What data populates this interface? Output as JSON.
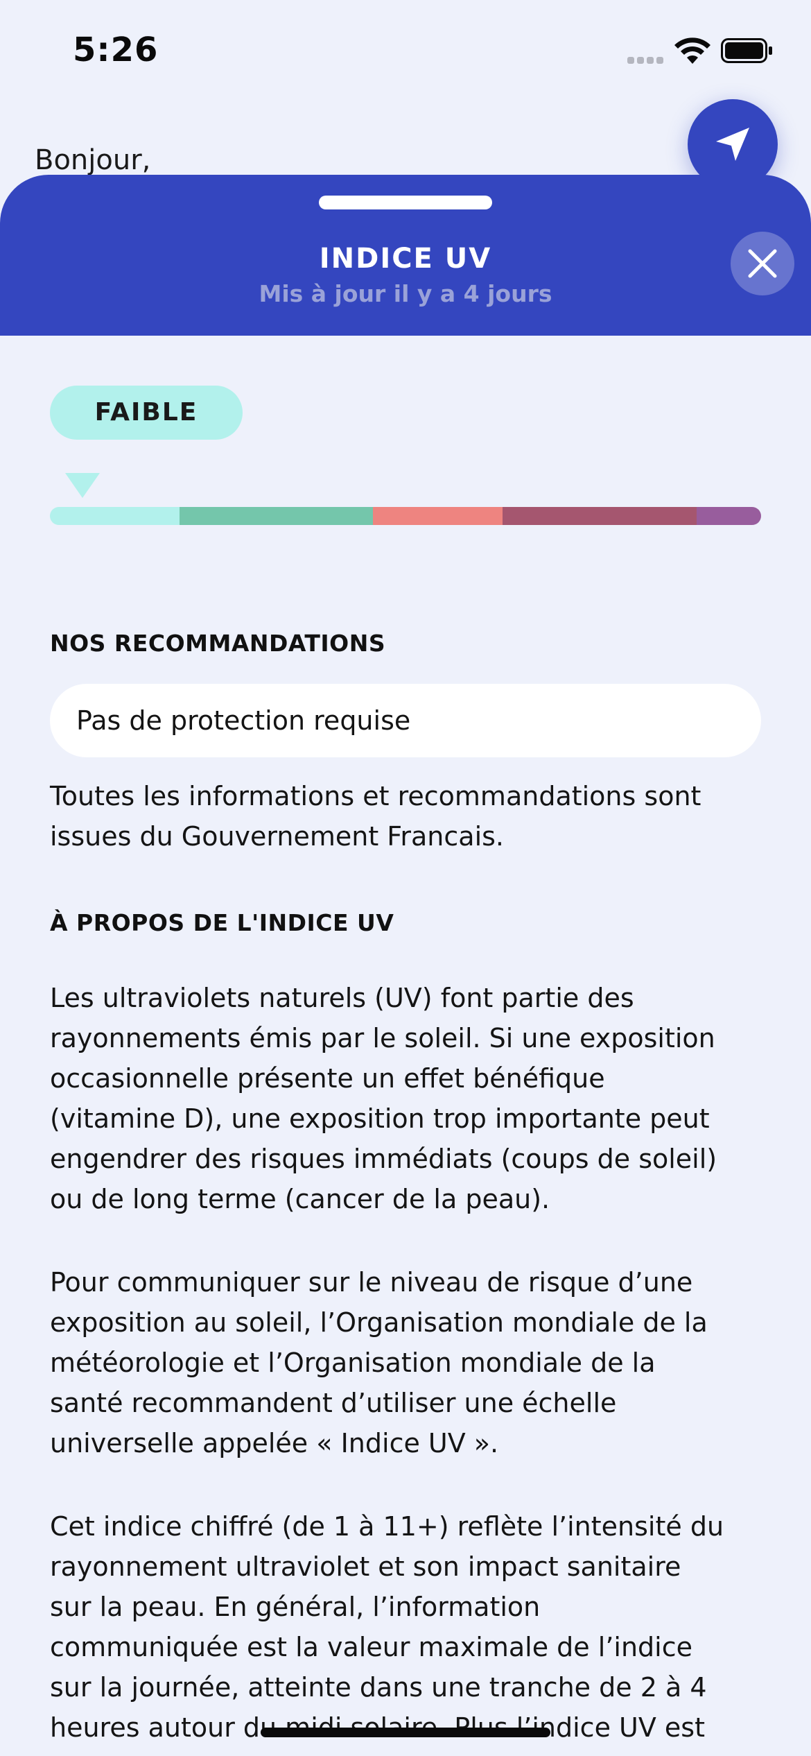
{
  "status_bar": {
    "time": "5:26"
  },
  "background": {
    "greeting": "Bonjour,"
  },
  "sheet": {
    "title": "INDICE UV",
    "subtitle": "Mis à jour il y a 4 jours"
  },
  "uv_level": {
    "label": "FAIBLE",
    "scale_colors": [
      "#b2f1ec",
      "#74c6ab",
      "#ee8480",
      "#a5566f",
      "#985d9d"
    ],
    "scale_segment_weights": [
      2,
      3,
      2,
      3,
      1
    ],
    "current_index": 0
  },
  "recommendations": {
    "title": "NOS RECOMMANDATIONS",
    "text": "Pas de protection requise",
    "source_lines": [
      "Toutes les informations et recommandations sont",
      "issues du Gouvernement Francais."
    ]
  },
  "about": {
    "title": "À PROPOS DE L'INDICE UV",
    "paragraph1": [
      "Les ultraviolets naturels (UV) font partie des",
      "rayonnements émis par le soleil. Si une exposition",
      "occasionnelle présente un effet bénéfique",
      "(vitamine D), une exposition trop importante peut",
      "engendrer des risques immédiats (coups de soleil)",
      "ou de long terme (cancer de la peau)."
    ],
    "paragraph2": [
      "Pour communiquer sur le niveau de risque d’une",
      "exposition au soleil, l’Organisation mondiale de la",
      "météorologie et l’Organisation mondiale de la",
      "santé recommandent d’utiliser une échelle",
      "universelle appelée « Indice UV »."
    ],
    "paragraph3": [
      "Cet indice chiffré (de 1 à 11+) reflète l’intensité du",
      "rayonnement ultraviolet et son impact sanitaire",
      "sur la peau. En général, l’information",
      "communiquée est la valeur maximale de l’indice",
      "sur la journée, atteinte dans une tranche de 2 à 4",
      "heures autour du midi solaire. Plus l’indice UV est"
    ]
  },
  "icons": {
    "status": [
      "signal-icon",
      "wifi-icon",
      "battery-icon"
    ],
    "locate": "location-arrow-icon",
    "close": "close-icon"
  }
}
